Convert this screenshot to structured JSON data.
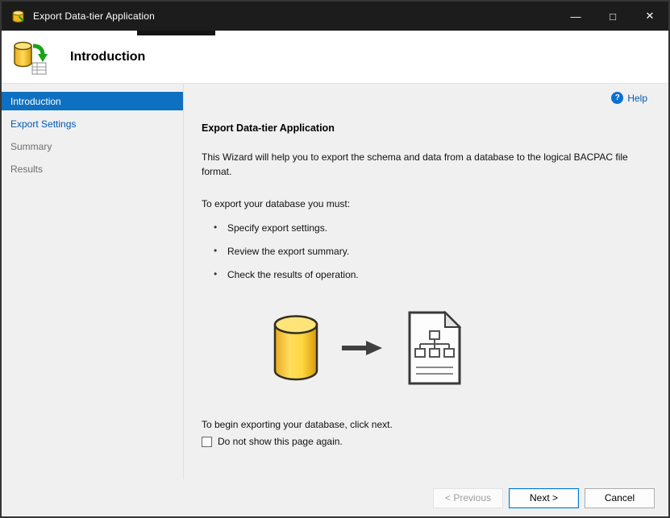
{
  "window": {
    "title": "Export Data-tier Application",
    "controls": {
      "minimize_glyph": "—",
      "maximize_glyph": "□",
      "close_glyph": "✕"
    }
  },
  "header": {
    "title": "Introduction"
  },
  "sidebar": {
    "items": [
      {
        "label": "Introduction",
        "state": "selected"
      },
      {
        "label": "Export Settings",
        "state": "enabled"
      },
      {
        "label": "Summary",
        "state": "disabled"
      },
      {
        "label": "Results",
        "state": "disabled"
      }
    ]
  },
  "content": {
    "help_label": "Help",
    "help_icon_glyph": "?",
    "heading": "Export Data-tier Application",
    "intro": "This Wizard will help you to export the schema and data from a database to the logical BACPAC file format.",
    "must_text": "To export your database you must:",
    "bullets": [
      "Specify export settings.",
      "Review the export summary.",
      "Check the results of operation."
    ],
    "illustration": {
      "from_icon": "database-icon",
      "to_icon": "bacpac-file-icon"
    },
    "begin_text": "To begin exporting your database, click next.",
    "checkbox_label": "Do not show this page again.",
    "checkbox_checked": false
  },
  "footer": {
    "previous_label": "< Previous",
    "next_label": "Next >",
    "cancel_label": "Cancel"
  },
  "colors": {
    "accent": "#0078d4",
    "titlebar_bg": "#1c1c1c",
    "sidebar_selected_bg": "#0e70c0",
    "link": "#0057b8",
    "database_yellow": "#ffd741"
  }
}
